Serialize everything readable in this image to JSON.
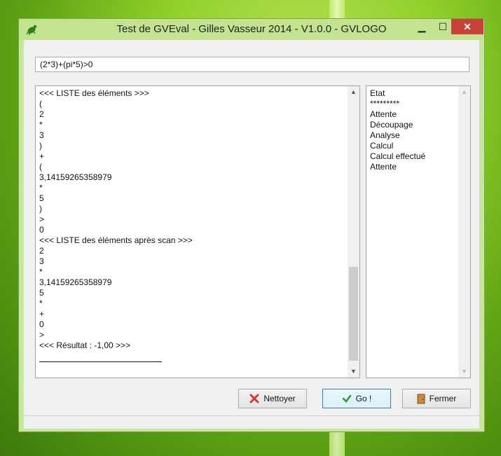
{
  "window": {
    "title": "Test de GVEval - Gilles Vasseur 2014 - V1.0.0 - GVLOGO",
    "minimize_glyph": "▁",
    "maximize_glyph": "☐",
    "close_glyph": "✕"
  },
  "expression": {
    "value": "(2*3)+(pi*5)>0"
  },
  "log": {
    "lines": [
      "<<< LISTE des éléments >>>",
      "(",
      "2",
      "*",
      "3",
      ")",
      "+",
      "(",
      "3,14159265358979",
      "*",
      "5",
      ")",
      ">",
      "0",
      "<<< LISTE des éléments après scan >>>",
      "2",
      "3",
      "*",
      "3,14159265358979",
      "5",
      "*",
      "+",
      "0",
      ">",
      "<<< Résultat : -1,00 >>>"
    ]
  },
  "state": {
    "lines": [
      "Etat",
      "*********",
      "Attente",
      "Découpage",
      "Analyse",
      "Calcul",
      "Calcul effectué",
      "Attente"
    ]
  },
  "buttons": {
    "clear": {
      "label": "Nettoyer",
      "icon": "red-x-icon"
    },
    "go": {
      "label": "Go !",
      "icon": "green-check-icon"
    },
    "close": {
      "label": "Fermer",
      "icon": "door-icon"
    }
  },
  "colors": {
    "titlebar": "#c3e38f",
    "close_button": "#c7413a",
    "go_border": "#3c7fb1"
  }
}
